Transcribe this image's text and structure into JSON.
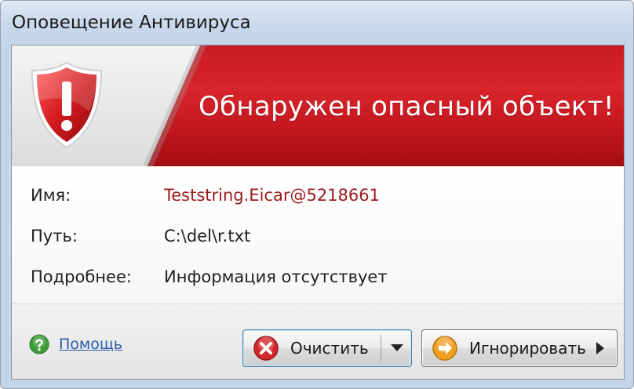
{
  "window": {
    "title": "Оповещение Антивируса"
  },
  "banner": {
    "title": "Обнаружен опасный объект!"
  },
  "details": {
    "name_label": "Имя:",
    "name_value": "Teststring.Eicar@5218661",
    "path_label": "Путь:",
    "path_value": "C:\\del\\r.txt",
    "more_label": "Подробнее:",
    "more_value": "Информация отсутствует"
  },
  "footer": {
    "help_label": "Помощь",
    "clean_label": "Очистить",
    "ignore_label": "Игнорировать"
  },
  "colors": {
    "banner_red": "#c91a22",
    "threat_name": "#9b1b1b",
    "link_blue": "#2b5bab"
  },
  "icons": {
    "shield": "shield-alert-icon",
    "help": "question-icon",
    "clean": "delete-x-icon",
    "ignore": "arrow-right-icon"
  }
}
